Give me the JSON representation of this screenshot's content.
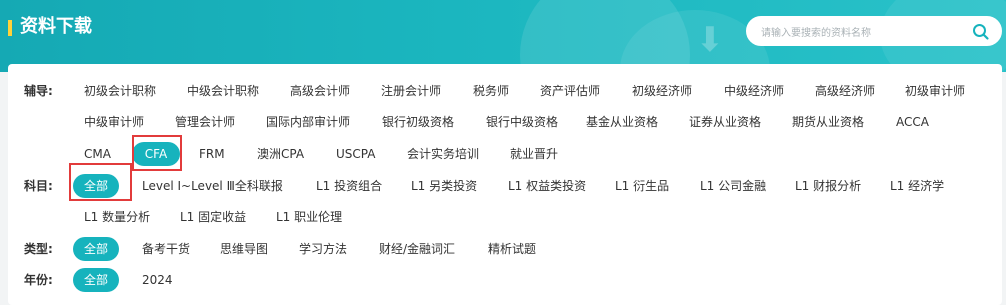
{
  "header": {
    "title": "资料下载",
    "search_placeholder": "请输入要搜索的资料名称"
  },
  "filters": {
    "fudao": {
      "label": "辅导:",
      "row1": [
        "初级会计职称",
        "中级会计职称",
        "高级会计师",
        "注册会计师",
        "税务师",
        "资产评估师",
        "初级经济师",
        "中级经济师",
        "高级经济师",
        "初级审计师"
      ],
      "row2": [
        "中级审计师",
        "管理会计师",
        "国际内部审计师",
        "银行初级资格",
        "银行中级资格",
        "基金从业资格",
        "证券从业资格",
        "期货从业资格",
        "ACCA"
      ],
      "row3": [
        "CMA",
        "CFA",
        "FRM",
        "澳洲CPA",
        "USCPA",
        "会计实务培训",
        "就业晋升"
      ],
      "active": "CFA"
    },
    "kemu": {
      "label": "科目:",
      "row1": [
        "全部",
        "Level Ⅰ~Level Ⅲ全科联报",
        "L1 投资组合",
        "L1 另类投资",
        "L1 权益类投资",
        "L1 衍生品",
        "L1 公司金融",
        "L1 财报分析",
        "L1 经济学"
      ],
      "row2": [
        "L1 数量分析",
        "L1 固定收益",
        "L1 职业伦理"
      ],
      "active": "全部"
    },
    "leixing": {
      "label": "类型:",
      "items": [
        "全部",
        "备考干货",
        "思维导图",
        "学习方法",
        "财经/金融词汇",
        "精析试题"
      ],
      "active": "全部"
    },
    "nianfen": {
      "label": "年份:",
      "items": [
        "全部",
        "2024"
      ],
      "active": "全部"
    }
  },
  "colors": {
    "accent": "#16b3bd",
    "highlight_box": "#e23b3b",
    "title_marker": "#ffd23a"
  }
}
